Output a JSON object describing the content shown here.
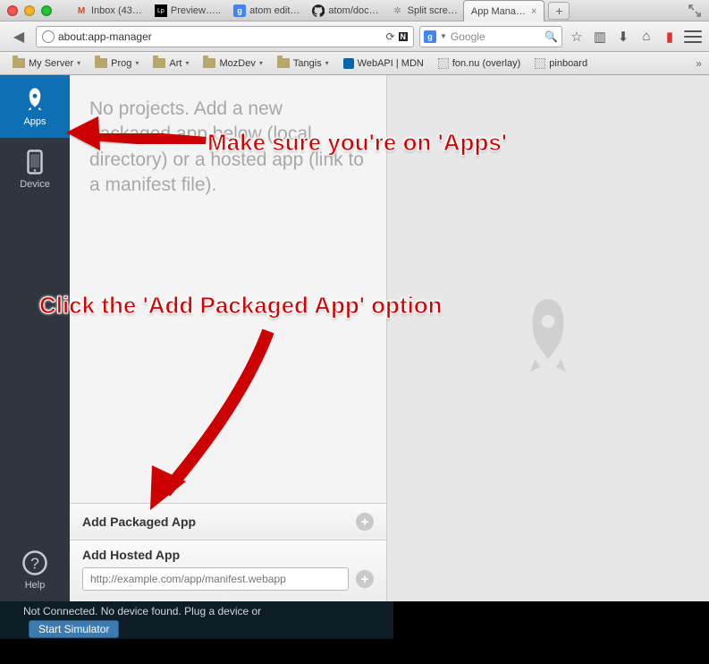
{
  "window": {
    "title": ""
  },
  "tabs": [
    {
      "label": "Inbox (43…",
      "favicon": "M",
      "active": false
    },
    {
      "label": "Preview…..",
      "favicon": "Lp",
      "active": false
    },
    {
      "label": "atom edit…",
      "favicon": "g",
      "active": false
    },
    {
      "label": "atom/doc…",
      "favicon": "gh",
      "active": false
    },
    {
      "label": "Split scre…",
      "favicon": "✽",
      "active": false
    },
    {
      "label": "App Mana…",
      "favicon": "",
      "active": true
    }
  ],
  "url": "about:app-manager",
  "search": {
    "placeholder": "Google",
    "engine_label": "g"
  },
  "bookmarks": [
    {
      "label": "My Server",
      "type": "folder"
    },
    {
      "label": "Prog",
      "type": "folder"
    },
    {
      "label": "Art",
      "type": "folder"
    },
    {
      "label": "MozDev",
      "type": "folder"
    },
    {
      "label": "Tangis",
      "type": "folder"
    },
    {
      "label": "WebAPI | MDN",
      "type": "link"
    },
    {
      "label": "fon.nu (overlay)",
      "type": "link-plain"
    },
    {
      "label": "pinboard",
      "type": "link-plain"
    }
  ],
  "rail": {
    "apps": "Apps",
    "device": "Device",
    "help": "Help"
  },
  "projects": {
    "empty_message": "No projects. Add a new packaged app below (local directory) or a hosted app (link to a manifest file).",
    "add_packaged_label": "Add Packaged App",
    "add_hosted_label": "Add Hosted App",
    "hosted_placeholder": "http://example.com/app/manifest.webapp"
  },
  "bottom": {
    "status": "Not Connected. No device found. Plug a device or",
    "button": "Start Simulator"
  },
  "annotations": {
    "a1": "Make sure you're on 'Apps'",
    "a2": "Click the 'Add Packaged App' option"
  },
  "colors": {
    "accent_blue": "#0f6fb3",
    "rail_bg": "#2f3640",
    "annotation_red": "#d40000"
  }
}
